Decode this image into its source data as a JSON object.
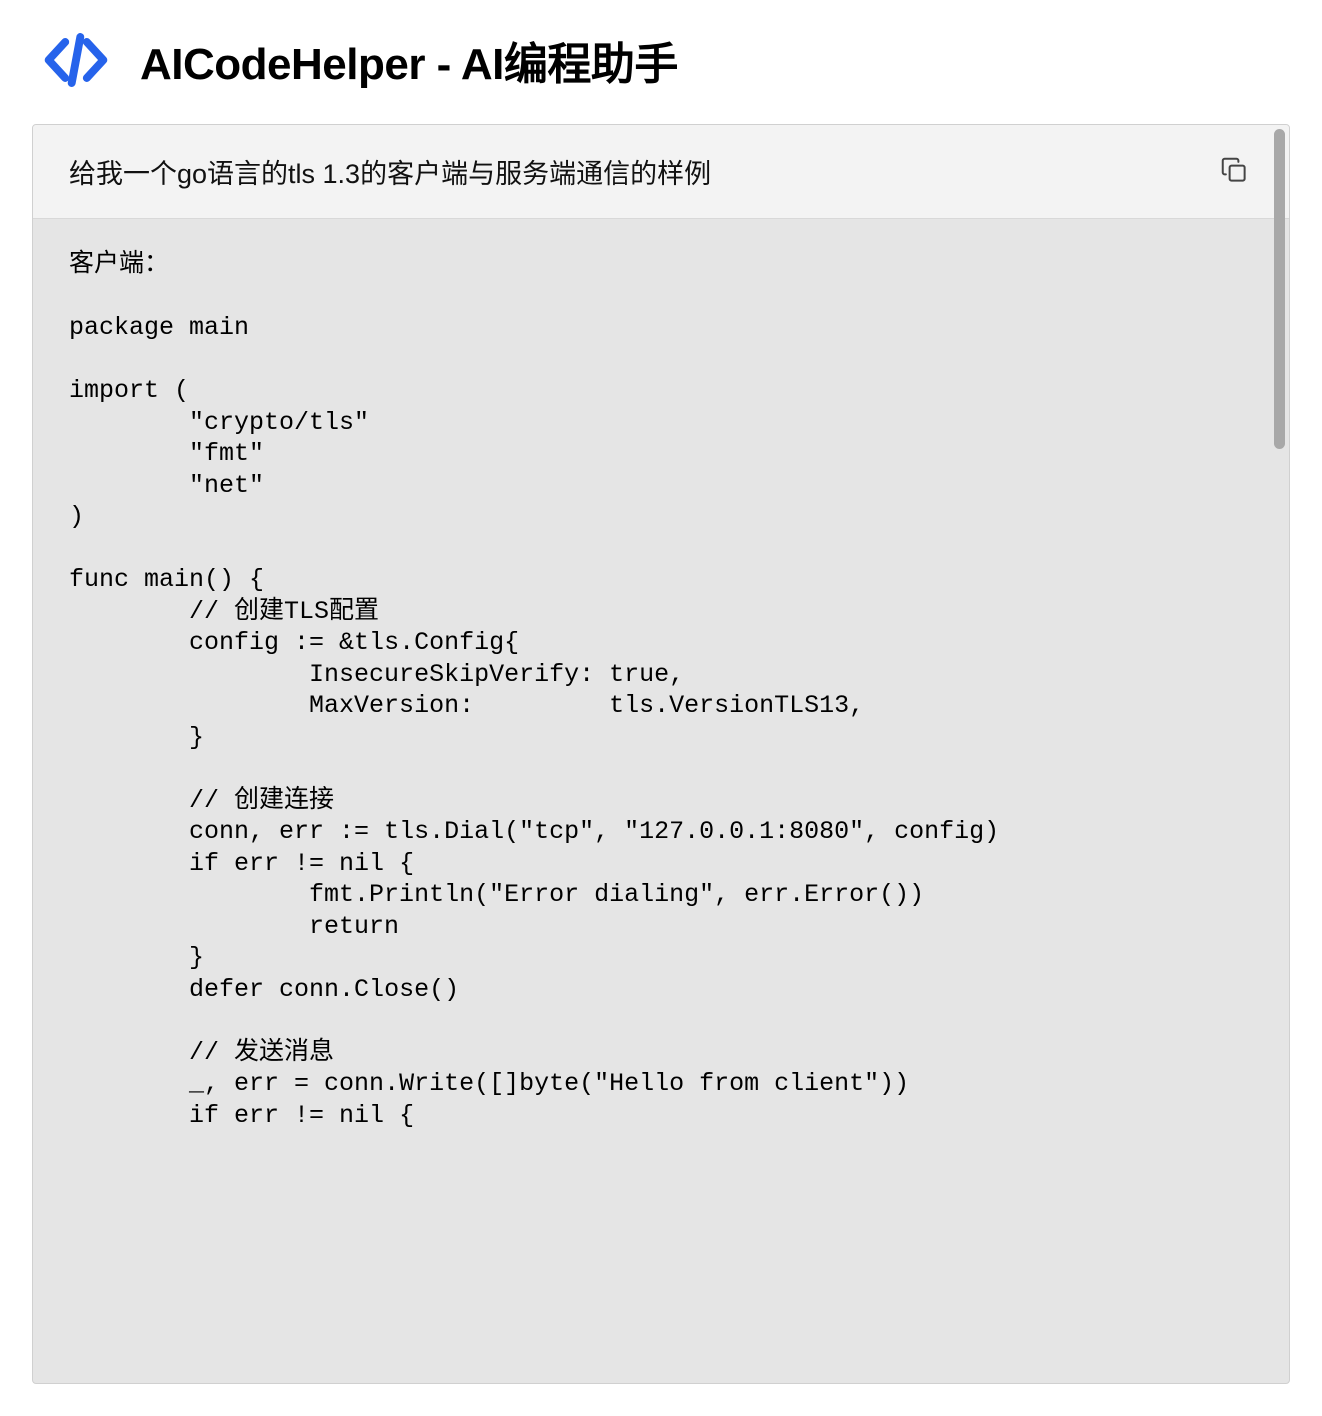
{
  "header": {
    "title": "AICodeHelper - AI编程助手",
    "logo_color": "#2663EB"
  },
  "card": {
    "prompt": "给我一个go语言的tls 1.3的客户端与服务端通信的样例",
    "response": "客户端：\n\npackage main\n\nimport (\n        \"crypto/tls\"\n        \"fmt\"\n        \"net\"\n)\n\nfunc main() {\n        // 创建TLS配置\n        config := &tls.Config{\n                InsecureSkipVerify: true,\n                MaxVersion:         tls.VersionTLS13,\n        }\n\n        // 创建连接\n        conn, err := tls.Dial(\"tcp\", \"127.0.0.1:8080\", config)\n        if err != nil {\n                fmt.Println(\"Error dialing\", err.Error())\n                return\n        }\n        defer conn.Close()\n\n        // 发送消息\n        _, err = conn.Write([]byte(\"Hello from client\"))\n        if err != nil {"
  },
  "icons": {
    "logo": "code-brackets-icon",
    "copy": "copy-icon"
  }
}
